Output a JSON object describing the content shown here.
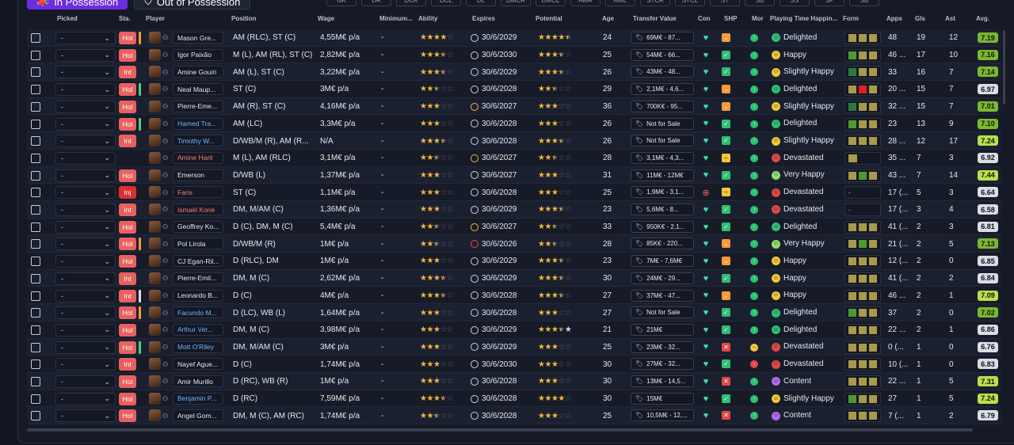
{
  "tabs": {
    "in_possession": "In Possession",
    "out_possession": "Out of Possession"
  },
  "filters": [
    "GK",
    "DR",
    "DCR",
    "DCL",
    "DL",
    "DMCR",
    "DMCL",
    "AMR",
    "AML",
    "STCR",
    "STCL",
    "ST",
    "SB",
    "SS",
    "SP",
    "SB"
  ],
  "headers": {
    "picked": "Picked",
    "sta": "Sta.",
    "player": "Player",
    "position": "Position",
    "wage": "Wage",
    "minimum": "Minimum...",
    "ability": "Ability",
    "expires": "Expires",
    "potential": "Potential",
    "age": "Age",
    "transfer_value": "Transfer Value",
    "con": "Con",
    "shp": "SHP",
    "mor": "Mor",
    "playing_time": "Playing Time Happin...",
    "form": "Form",
    "apps": "Apps",
    "gls": "Gls",
    "ast": "Ast",
    "avg": "Avg."
  },
  "rows": [
    {
      "picked": "-",
      "sta": "Hol",
      "bar": "#f59a3b",
      "name": "Mason Gre...",
      "nc": "",
      "position": "AM (RLC), ST (C)",
      "wage": "4,55M€ p/a",
      "min": "-",
      "ab": "4",
      "expires": "30/6/2029",
      "ck": "",
      "pot": "4.5",
      "age": "24",
      "tv": "69M€ - 87...",
      "con": "g",
      "shp": "o",
      "mor": "g",
      "pth": "Delighted",
      "emo": "g",
      "form": [
        "y",
        "y",
        "y"
      ],
      "apps": "48",
      "gls": "19",
      "ast": "12",
      "avg": "7.19",
      "avgc": "dg"
    },
    {
      "picked": "-",
      "sta": "Hol",
      "bar": "",
      "name": "Igor Paixão",
      "nc": "",
      "position": "M (L), AM (RL), ST (C)",
      "wage": "2,82M€ p/a",
      "min": "-",
      "ab": "3.5",
      "expires": "30/6/2030",
      "ck": "",
      "pot": "3.5",
      "age": "25",
      "tv": "54M€ - 66...",
      "con": "g",
      "shp": "g",
      "mor": "g",
      "pth": "Happy",
      "emo": "y",
      "form": [
        "g",
        "y",
        "y"
      ],
      "apps": "46 ...",
      "gls": "17",
      "ast": "10",
      "avg": "7.16",
      "avgc": "dg"
    },
    {
      "picked": "-",
      "sta": "Int",
      "bar": "",
      "name": "Amine Gouiri",
      "nc": "",
      "position": "AM (L), ST (C)",
      "wage": "3,22M€ p/a",
      "min": "-",
      "ab": "3.5",
      "expires": "30/6/2029",
      "ck": "",
      "pot": "3.5",
      "age": "26",
      "tv": "43M€ - 48...",
      "con": "g",
      "shp": "g",
      "mor": "g",
      "pth": "Slightly Happy",
      "emo": "y",
      "form": [
        "dg",
        "y",
        "y"
      ],
      "apps": "33",
      "gls": "16",
      "ast": "7",
      "avg": "7.14",
      "avgc": "dg"
    },
    {
      "picked": "-",
      "sta": "Hol",
      "bar": "#4fd07a",
      "name": "Neal Maup...",
      "nc": "",
      "position": "ST (C)",
      "wage": "3M€ p/a",
      "min": "-",
      "ab": "2.5",
      "expires": "30/6/2028",
      "ck": "",
      "pot": "2.5",
      "age": "29",
      "tv": "2,1M€ - 4,6...",
      "con": "g",
      "shp": "o",
      "mor": "g",
      "pth": "Delighted",
      "emo": "g",
      "form": [
        "y",
        "r",
        "y"
      ],
      "apps": "20 ...",
      "gls": "15",
      "ast": "7",
      "avg": "6.97",
      "avgc": "gr"
    },
    {
      "picked": "-",
      "sta": "Hol",
      "bar": "",
      "name": "Pierre-Eme...",
      "nc": "",
      "position": "AM (R), ST (C)",
      "wage": "4,16M€ p/a",
      "min": "-",
      "ab": "3",
      "expires": "30/6/2027",
      "ck": "y",
      "pot": "3",
      "age": "36",
      "tv": "700K€ - 95...",
      "con": "g",
      "shp": "o",
      "mor": "g",
      "pth": "Slightly Happy",
      "emo": "y",
      "form": [
        "dg",
        "y",
        "y"
      ],
      "apps": "32 ...",
      "gls": "15",
      "ast": "7",
      "avg": "7.01",
      "avgc": "dg"
    },
    {
      "picked": "-",
      "sta": "Hol",
      "bar": "#4fd07a",
      "name": "Hamed Tra...",
      "nc": "blue",
      "position": "AM (LC)",
      "wage": "3,3M€ p/a",
      "min": "-",
      "ab": "3",
      "expires": "30/6/2028",
      "ck": "",
      "pot": "3",
      "age": "26",
      "tv": "Not for Sale",
      "con": "g",
      "shp": "g",
      "mor": "g",
      "pth": "Delighted",
      "emo": "g",
      "form": [
        "g",
        "y",
        "y"
      ],
      "apps": "23",
      "gls": "13",
      "ast": "9",
      "avg": "7.10",
      "avgc": "dg"
    },
    {
      "picked": "-",
      "sta": "Int",
      "bar": "",
      "name": "Timothy W...",
      "nc": "blue",
      "position": "D/WB/M (R), AM (R...",
      "wage": "N/A",
      "min": "-",
      "ab": "3.5",
      "expires": "30/6/2028",
      "ck": "",
      "pot": "3.5",
      "age": "26",
      "tv": "Not for Sale",
      "con": "g",
      "shp": "g",
      "mor": "g",
      "pth": "Slightly Happy",
      "emo": "y",
      "form": [
        "y",
        "y",
        "y"
      ],
      "apps": "28 ...",
      "gls": "12",
      "ast": "17",
      "avg": "7.24",
      "avgc": "lg"
    },
    {
      "picked": "-",
      "sta": "",
      "bar": "",
      "name": "Amine Harit",
      "nc": "red",
      "position": "M (L), AM (RLC)",
      "wage": "3,1M€ p/a",
      "min": "-",
      "ab": "2.5",
      "expires": "30/6/2027",
      "ck": "y",
      "pot": "2.5",
      "age": "28",
      "tv": "3,1M€ - 4,3...",
      "con": "g",
      "shp": "y",
      "mor": "g",
      "pth": "Devastated",
      "emo": "r",
      "form": [
        "y"
      ],
      "apps": "35 ...",
      "gls": "7",
      "ast": "3",
      "avg": "6.92",
      "avgc": "gr"
    },
    {
      "picked": "-",
      "sta": "Hol",
      "bar": "",
      "name": "Emerson",
      "nc": "",
      "position": "D/WB (L)",
      "wage": "1,37M€ p/a",
      "min": "-",
      "ab": "3",
      "expires": "30/6/2027",
      "ck": "",
      "pot": "3",
      "age": "31",
      "tv": "11M€ - 12M€",
      "con": "g",
      "shp": "g",
      "mor": "g",
      "pth": "Very Happy",
      "emo": "lg",
      "form": [
        "y",
        "g",
        "y"
      ],
      "apps": "43 ...",
      "gls": "7",
      "ast": "14",
      "avg": "7.44",
      "avgc": "lg"
    },
    {
      "picked": "-",
      "sta": "Inj",
      "bar": "",
      "name": "Faris",
      "nc": "red",
      "position": "ST (C)",
      "wage": "1,1M€ p/a",
      "min": "-",
      "ab": "3",
      "expires": "30/6/2028",
      "ck": "",
      "pot": "3",
      "age": "25",
      "tv": "1,9M€ - 3,1...",
      "con": "red",
      "shp": "y",
      "mor": "g",
      "pth": "Devastated",
      "emo": "r",
      "form": [],
      "apps": "17 (...",
      "gls": "5",
      "ast": "3",
      "avg": "6.64",
      "avgc": "gr"
    },
    {
      "picked": "-",
      "sta": "Int",
      "bar": "",
      "name": "Ismaël Koné",
      "nc": "red",
      "position": "DM, M/AM (C)",
      "wage": "1,36M€ p/a",
      "min": "-",
      "ab": "3",
      "expires": "30/6/2029",
      "ck": "",
      "pot": "3.5",
      "age": "23",
      "tv": "5,6M€ - 8...",
      "con": "g",
      "shp": "g",
      "mor": "g",
      "pth": "Devastated",
      "emo": "r",
      "form": [],
      "apps": "17 (...",
      "gls": "3",
      "ast": "4",
      "avg": "6.58",
      "avgc": "gr"
    },
    {
      "picked": "-",
      "sta": "Hol",
      "bar": "",
      "name": "Geoffrey Ko...",
      "nc": "",
      "position": "D (C), DM, M (C)",
      "wage": "5,4M€ p/a",
      "min": "-",
      "ab": "2.5",
      "expires": "30/6/2027",
      "ck": "y",
      "pot": "2.5",
      "age": "33",
      "tv": "950K€ - 2,1...",
      "con": "g",
      "shp": "g",
      "mor": "g",
      "pth": "Delighted",
      "emo": "g",
      "form": [
        "y",
        "y",
        "y"
      ],
      "apps": "41 (...",
      "gls": "2",
      "ast": "3",
      "avg": "6.81",
      "avgc": "gr"
    },
    {
      "picked": "-",
      "sta": "Hol",
      "bar": "#f59a3b",
      "name": "Pol Lirola",
      "nc": "",
      "position": "D/WB/M (R)",
      "wage": "1M€ p/a",
      "min": "-",
      "ab": "2.5",
      "expires": "30/6/2026",
      "ck": "r",
      "pot": "2.5",
      "age": "28",
      "tv": "85K€ - 220...",
      "con": "g",
      "shp": "o",
      "mor": "g",
      "pth": "Very Happy",
      "emo": "lg",
      "form": [
        "y",
        "g",
        "y"
      ],
      "apps": "21 (...",
      "gls": "2",
      "ast": "5",
      "avg": "7.13",
      "avgc": "dg"
    },
    {
      "picked": "-",
      "sta": "Hol",
      "bar": "",
      "name": "CJ Egan-Ril...",
      "nc": "",
      "position": "D (RLC), DM",
      "wage": "1M€ p/a",
      "min": "-",
      "ab": "3",
      "expires": "30/6/2029",
      "ck": "",
      "pot": "3.5",
      "age": "23",
      "tv": "7M€ - 7,6M€",
      "con": "g",
      "shp": "o",
      "mor": "g",
      "pth": "Happy",
      "emo": "y",
      "form": [
        "y",
        "y",
        "y"
      ],
      "apps": "12 (...",
      "gls": "2",
      "ast": "0",
      "avg": "6.85",
      "avgc": "gr"
    },
    {
      "picked": "-",
      "sta": "Int",
      "bar": "",
      "name": "Pierre-Emil...",
      "nc": "",
      "position": "DM, M (C)",
      "wage": "2,62M€ p/a",
      "min": "-",
      "ab": "3.5",
      "expires": "30/6/2029",
      "ck": "",
      "pot": "3.5",
      "age": "30",
      "tv": "24M€ - 29...",
      "con": "g",
      "shp": "g",
      "mor": "g",
      "pth": "Happy",
      "emo": "y",
      "form": [
        "y",
        "y",
        "y"
      ],
      "apps": "41 (...",
      "gls": "2",
      "ast": "2",
      "avg": "6.84",
      "avgc": "gr"
    },
    {
      "picked": "-",
      "sta": "Int",
      "bar": "#d9dde5",
      "name": "Leonardo B...",
      "nc": "",
      "position": "D (C)",
      "wage": "4M€ p/a",
      "min": "-",
      "ab": "3.5",
      "expires": "30/6/2028",
      "ck": "",
      "pot": "3.5",
      "age": "27",
      "tv": "37M€ - 47...",
      "con": "g",
      "shp": "o",
      "mor": "g",
      "pth": "Happy",
      "emo": "y",
      "form": [
        "y",
        "y",
        "y"
      ],
      "apps": "46 ...",
      "gls": "2",
      "ast": "1",
      "avg": "7.09",
      "avgc": "lg"
    },
    {
      "picked": "-",
      "sta": "Hol",
      "bar": "#f59a3b",
      "name": "Facundo M...",
      "nc": "blue",
      "position": "D (LC), WB (L)",
      "wage": "1,64M€ p/a",
      "min": "-",
      "ab": "3",
      "expires": "30/6/2028",
      "ck": "",
      "pot": "3",
      "age": "27",
      "tv": "Not for Sale",
      "con": "g",
      "shp": "g",
      "mor": "g",
      "pth": "Delighted",
      "emo": "g",
      "form": [
        "g",
        "y",
        "y"
      ],
      "apps": "37",
      "gls": "2",
      "ast": "0",
      "avg": "7.02",
      "avgc": "dg"
    },
    {
      "picked": "-",
      "sta": "Hol",
      "bar": "",
      "name": "Arthur Ver...",
      "nc": "blue",
      "position": "DM, M (C)",
      "wage": "3,98M€ p/a",
      "min": "-",
      "ab": "3",
      "expires": "30/6/2029",
      "ck": "",
      "pot": "3.5w",
      "age": "21",
      "tv": "21M€",
      "con": "g",
      "shp": "g",
      "mor": "g",
      "pth": "Delighted",
      "emo": "g",
      "form": [
        "y",
        "y",
        "y"
      ],
      "apps": "22 ...",
      "gls": "2",
      "ast": "1",
      "avg": "6.86",
      "avgc": "gr"
    },
    {
      "picked": "-",
      "sta": "Hol",
      "bar": "#4fd07a",
      "name": "Mott O'Riley",
      "nc": "blue",
      "position": "DM, M/AM (C)",
      "wage": "3M€ p/a",
      "min": "-",
      "ab": "3",
      "expires": "30/6/2029",
      "ck": "",
      "pot": "3",
      "age": "25",
      "tv": "23M€ - 32...",
      "con": "g",
      "shp": "r",
      "mor": "y",
      "pth": "Devastated",
      "emo": "r",
      "form": [
        "y",
        "y",
        "y"
      ],
      "apps": "0 (...",
      "gls": "1",
      "ast": "0",
      "avg": "6.76",
      "avgc": "gr"
    },
    {
      "picked": "-",
      "sta": "Int",
      "bar": "",
      "name": "Nayef Ague...",
      "nc": "",
      "position": "D (C)",
      "wage": "1,74M€ p/a",
      "min": "-",
      "ab": "3",
      "expires": "30/6/2030",
      "ck": "",
      "pot": "3",
      "age": "30",
      "tv": "27M€ - 32...",
      "con": "g",
      "shp": "g",
      "mor": "r",
      "pth": "Devastated",
      "emo": "r",
      "form": [
        "y",
        "y",
        "y"
      ],
      "apps": "10 (...",
      "gls": "1",
      "ast": "0",
      "avg": "6.83",
      "avgc": "gr"
    },
    {
      "picked": "-",
      "sta": "Hol",
      "bar": "",
      "name": "Amir Murillo",
      "nc": "",
      "position": "D (RC), WB (R)",
      "wage": "1M€ p/a",
      "min": "-",
      "ab": "3",
      "expires": "30/6/2028",
      "ck": "",
      "pot": "3",
      "age": "30",
      "tv": "13M€ - 14,5...",
      "con": "g",
      "shp": "r",
      "mor": "g",
      "pth": "Content",
      "emo": "p",
      "form": [
        "y",
        "y",
        "y"
      ],
      "apps": "22 ...",
      "gls": "1",
      "ast": "5",
      "avg": "7.31",
      "avgc": "lg"
    },
    {
      "picked": "-",
      "sta": "Hol",
      "bar": "",
      "name": "Benjamin P...",
      "nc": "blue",
      "position": "D (RC)",
      "wage": "7,59M€ p/a",
      "min": "-",
      "ab": "3.5",
      "expires": "30/6/2028",
      "ck": "",
      "pot": "4",
      "age": "30",
      "tv": "15M€",
      "con": "g",
      "shp": "g",
      "mor": "g",
      "pth": "Slightly Happy",
      "emo": "y",
      "form": [
        "g",
        "y",
        "y"
      ],
      "apps": "27",
      "gls": "1",
      "ast": "5",
      "avg": "7.24",
      "avgc": "lg"
    },
    {
      "picked": "-",
      "sta": "Hol",
      "bar": "",
      "name": "Angel Gom...",
      "nc": "",
      "position": "DM, M (C), AM (RC)",
      "wage": "1,74M€ p/a",
      "min": "-",
      "ab": "2.5",
      "expires": "30/6/2028",
      "ck": "",
      "pot": "3",
      "age": "25",
      "tv": "10,5M€ - 12,...",
      "con": "g",
      "shp": "r",
      "mor": "g",
      "pth": "Content",
      "emo": "p",
      "form": [
        "y",
        "y",
        "y"
      ],
      "apps": "7 (...",
      "gls": "1",
      "ast": "2",
      "avg": "6.79",
      "avgc": "gr"
    }
  ]
}
